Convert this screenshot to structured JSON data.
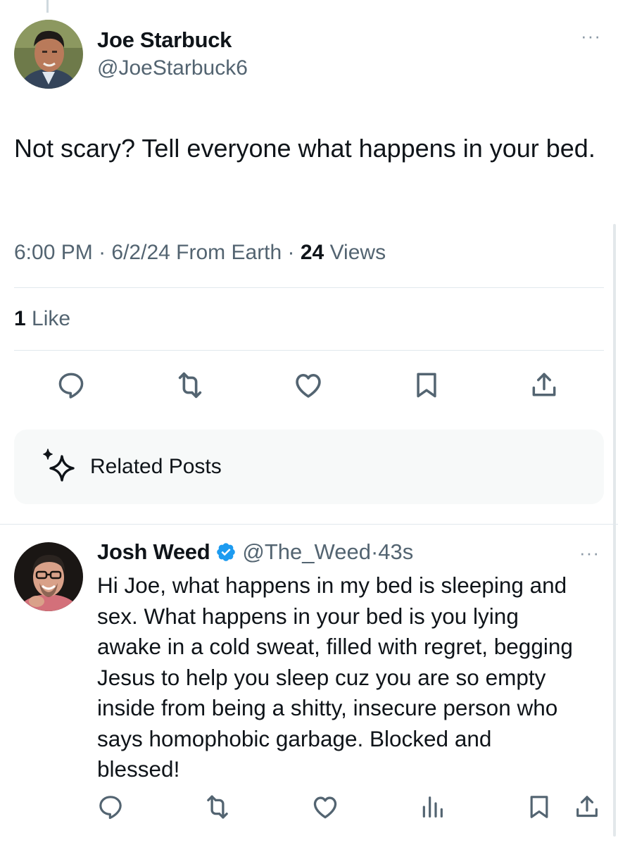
{
  "main_post": {
    "author_name": "Joe Starbuck",
    "author_handle": "@JoeStarbuck6",
    "more_label": "···",
    "text": "Not scary? Tell everyone what happens in your bed.",
    "time": "6:00 PM",
    "date": "6/2/24",
    "source": "From Earth",
    "views_count": "24",
    "views_label": "Views",
    "likes_count": "1",
    "likes_label": "Like"
  },
  "actions": {
    "icons": [
      "reply-icon",
      "repost-icon",
      "like-icon",
      "bookmark-icon",
      "share-icon"
    ]
  },
  "related": {
    "label": "Related Posts",
    "icon": "sparkle-icon"
  },
  "reply": {
    "author_name": "Josh Weed",
    "verified": true,
    "author_handle": "@The_Weed",
    "separator": "·",
    "time_ago": "43s",
    "more_label": "···",
    "text": "Hi Joe, what happens in my bed is sleeping and\nsex. What happens in your bed is you lying\nawake in a cold sweat, filled with regret, begging\nJesus to help you sleep cuz you are so empty\ninside from being a shitty, insecure person who\nsays homophobic garbage. Blocked and\nblessed!",
    "icons": [
      "reply-icon",
      "repost-icon",
      "views-icon",
      "bookmark-icon",
      "share-icon"
    ]
  },
  "colors": {
    "text_primary": "#0f1419",
    "text_secondary": "#536471",
    "divider": "#e1e8ed",
    "verified_blue": "#1d9bf0",
    "related_bg": "#f7f9f9"
  }
}
